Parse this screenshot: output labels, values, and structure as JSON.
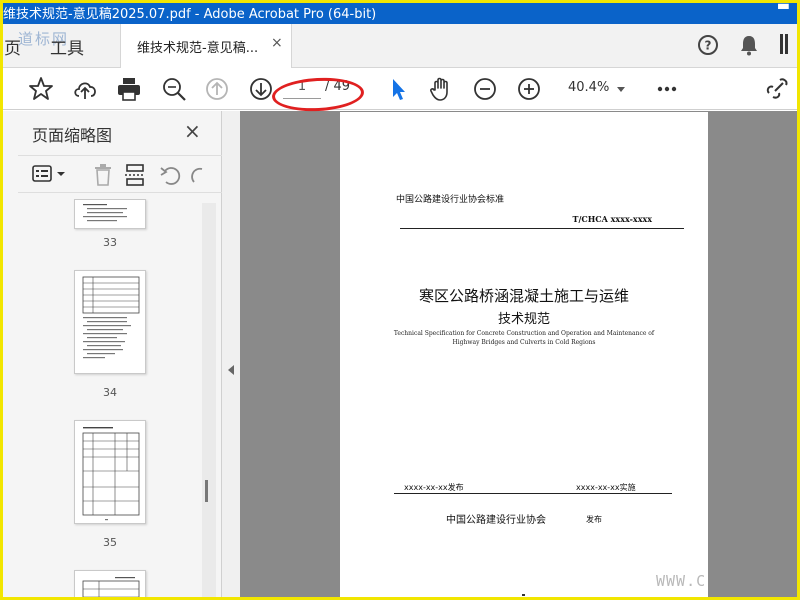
{
  "window": {
    "title": "维技术规范-意见稿2025.07.pdf - Adobe Acrobat Pro (64-bit)"
  },
  "menu": {
    "page_label": "页",
    "tools_label": "工具",
    "watermark": "道标网"
  },
  "tab": {
    "label": "维技术规范-意见稿...",
    "close": "×"
  },
  "toolbar": {
    "page_current": "1",
    "page_total": "/ 49",
    "zoom": "40.4%"
  },
  "sidebar": {
    "title": "页面缩略图",
    "close": "×",
    "thumbnails": [
      {
        "page": "33"
      },
      {
        "page": "34"
      },
      {
        "page": "35"
      }
    ]
  },
  "document": {
    "org_standard": "中国公路建设行业协会标准",
    "code": "T/CHCA xxxx-xxxx",
    "title_line1": "寒区公路桥涵混凝土施工与运维",
    "title_line2": "技术规范",
    "english_title": "Technical Specification for Concrete Construction and Operation and Maintenance of Highway Bridges and Culverts in Cold Regions",
    "issue_date": "xxxx-xx-xx发布",
    "implement_date": "xxxx-xx-xx实施",
    "association": "中国公路建设行业协会",
    "publish": "发布"
  },
  "watermark_bottom": "WWW.C",
  "colors": {
    "titlebar": "#0a63c9",
    "highlight": "#e02020",
    "select_arrow": "#1473e6",
    "frame": "#f2e600"
  }
}
